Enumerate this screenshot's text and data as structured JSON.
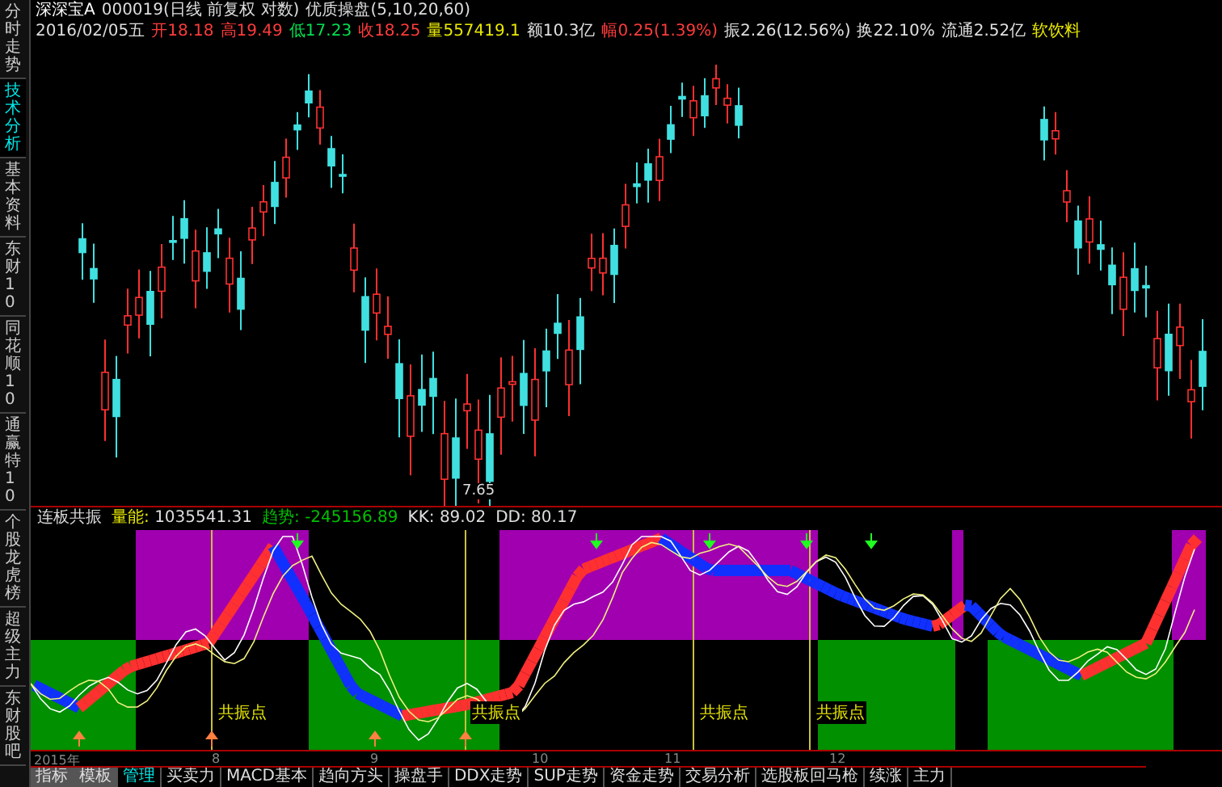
{
  "sidebar": {
    "tabs": [
      {
        "label": "分时走势",
        "selected": false
      },
      {
        "label": "技术分析",
        "selected": true
      },
      {
        "label": "基本资料",
        "selected": false
      },
      {
        "label": "东财10",
        "selected": false
      },
      {
        "label": "同花顺10",
        "selected": false
      },
      {
        "label": "通赢特10",
        "selected": false
      },
      {
        "label": "个股龙虎榜",
        "selected": false
      },
      {
        "label": "超级主力",
        "selected": false
      },
      {
        "label": "东财股吧",
        "selected": false
      }
    ]
  },
  "header": {
    "title": "深深宝A",
    "code": "000019(日线 前复权 对数)",
    "indicator": "优质操盘(5,10,20,60)",
    "date": "2016/02/05五",
    "quotes": [
      {
        "label": "开",
        "value": "18.18",
        "kind": "up"
      },
      {
        "label": "高",
        "value": "19.49",
        "kind": "up"
      },
      {
        "label": "低",
        "value": "17.23",
        "kind": "down"
      },
      {
        "label": "收",
        "value": "18.25",
        "kind": "up"
      },
      {
        "label": "量",
        "value": "557419.1",
        "kind": "volume"
      },
      {
        "label": "额",
        "value": "10.3亿",
        "kind": "plain"
      },
      {
        "label": "幅",
        "value": "0.25(1.39%)",
        "kind": "up"
      },
      {
        "label": "振",
        "value": "2.26(12.56%)",
        "kind": "plain"
      },
      {
        "label": "换",
        "value": "22.10%",
        "kind": "plain"
      },
      {
        "label": "流通",
        "value": "2.52亿",
        "kind": "plain"
      }
    ],
    "industry": "软饮料"
  },
  "price_chart": {
    "low_label": "7.65"
  },
  "indicator_panel": {
    "name": "连板共振",
    "readings": [
      {
        "label": "量能:",
        "value": "1035541.31",
        "kind": "volume"
      },
      {
        "label": "趋势:",
        "value": "-245156.89",
        "kind": "trend"
      },
      {
        "label": "KK:",
        "value": "89.02",
        "kind": "plain"
      },
      {
        "label": "DD:",
        "value": "80.17",
        "kind": "plain"
      }
    ],
    "signal_labels": [
      "共振点",
      "共振点",
      "共振点",
      "共振点"
    ]
  },
  "x_axis": {
    "labels": [
      "2015年",
      "8",
      "9",
      "10",
      "11",
      "12"
    ]
  },
  "bottom_tabs": [
    {
      "label": "指标",
      "kind": "menu",
      "selected": false
    },
    {
      "label": "模板",
      "kind": "menu",
      "selected": false
    },
    {
      "label": "管理",
      "kind": "tab",
      "selected": true
    },
    {
      "label": "买卖力",
      "kind": "tab",
      "selected": false
    },
    {
      "label": "MACD基本",
      "kind": "tab",
      "selected": false
    },
    {
      "label": "趋向方头",
      "kind": "tab",
      "selected": false
    },
    {
      "label": "操盘手",
      "kind": "tab",
      "selected": false
    },
    {
      "label": "DDX走势",
      "kind": "tab",
      "selected": false
    },
    {
      "label": "SUP走势",
      "kind": "tab",
      "selected": false
    },
    {
      "label": "资金走势",
      "kind": "tab",
      "selected": false
    },
    {
      "label": "交易分析",
      "kind": "tab",
      "selected": false
    },
    {
      "label": "选股板回马枪",
      "kind": "tab",
      "selected": false
    },
    {
      "label": "续涨",
      "kind": "tab",
      "selected": false
    },
    {
      "label": "主力",
      "kind": "tab",
      "selected": false
    }
  ]
}
